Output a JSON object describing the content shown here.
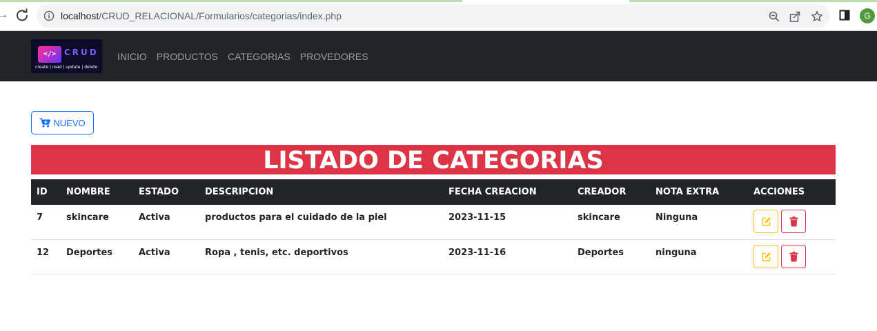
{
  "browser": {
    "url_host": "localhost",
    "url_path": "/CRUD_RELACIONAL/Formularios/categorias/index.php",
    "profile_initial": "G"
  },
  "brand": {
    "code_glyph": "</>",
    "name": "CRUD",
    "tagline": "create | read | update | delete"
  },
  "nav": {
    "items": [
      "INICIO",
      "PRODUCTOS",
      "CATEGORIAS",
      "PROVEDORES"
    ]
  },
  "new_button": {
    "label": "NUEVO",
    "icon": "cart-plus-icon"
  },
  "banner_title": "LISTADO DE CATEGORIAS",
  "table": {
    "headers": [
      "ID",
      "NOMBRE",
      "ESTADO",
      "DESCRIPCION",
      "FECHA CREACION",
      "CREADOR",
      "NOTA EXTRA",
      "ACCIONES"
    ],
    "rows": [
      {
        "id": "7",
        "nombre": "skincare",
        "estado": "Activa",
        "descripcion": "productos para el cuidado de la piel",
        "fecha": "2023-11-15",
        "creador": "skincare",
        "nota": "Ninguna"
      },
      {
        "id": "12",
        "nombre": "Deportes",
        "estado": "Activa",
        "descripcion": "Ropa , tenis, etc. deportivos",
        "fecha": "2023-11-16",
        "creador": "Deportes",
        "nota": "ninguna"
      }
    ]
  },
  "colors": {
    "primary": "#0d6efd",
    "danger": "#dc3545",
    "warning": "#ffc107",
    "dark": "#212529"
  }
}
